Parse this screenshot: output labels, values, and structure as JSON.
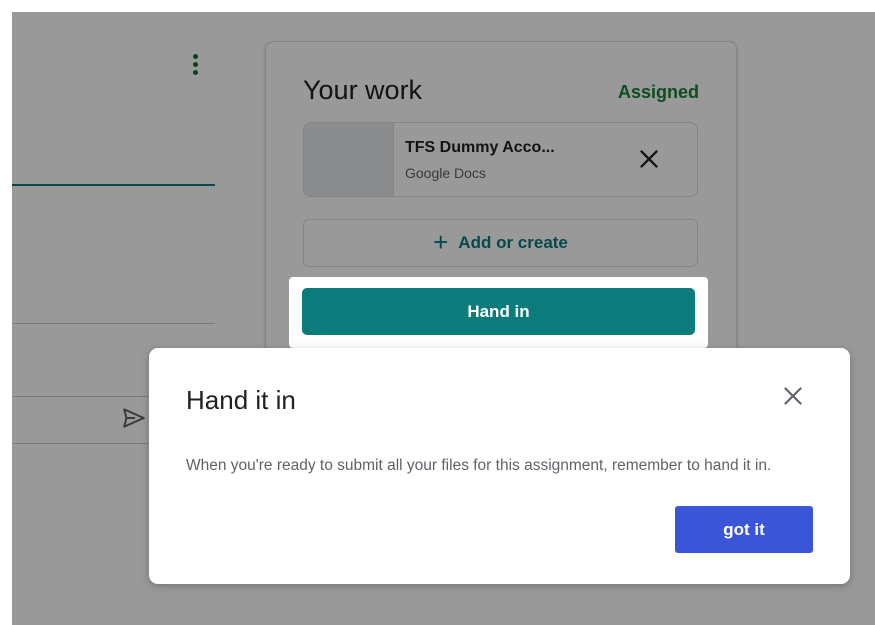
{
  "card": {
    "title": "Your work",
    "status": "Assigned",
    "status_color": "#188038",
    "attachment": {
      "name": "TFS Dummy Acco...",
      "type": "Google Docs"
    },
    "add_label": "Add or create",
    "hand_in_label": "Hand in",
    "accent_color": "#0b7b7b"
  },
  "dialog": {
    "title": "Hand it in",
    "body": "When you're ready to submit all your files for this assignment, remember to hand it in.",
    "button_label": "got it",
    "button_color": "#3b55d9"
  },
  "icons": {
    "kebab": "more-vert-icon",
    "remove": "close-icon",
    "add": "plus-icon",
    "send": "send-icon",
    "dialog_close": "close-icon"
  }
}
